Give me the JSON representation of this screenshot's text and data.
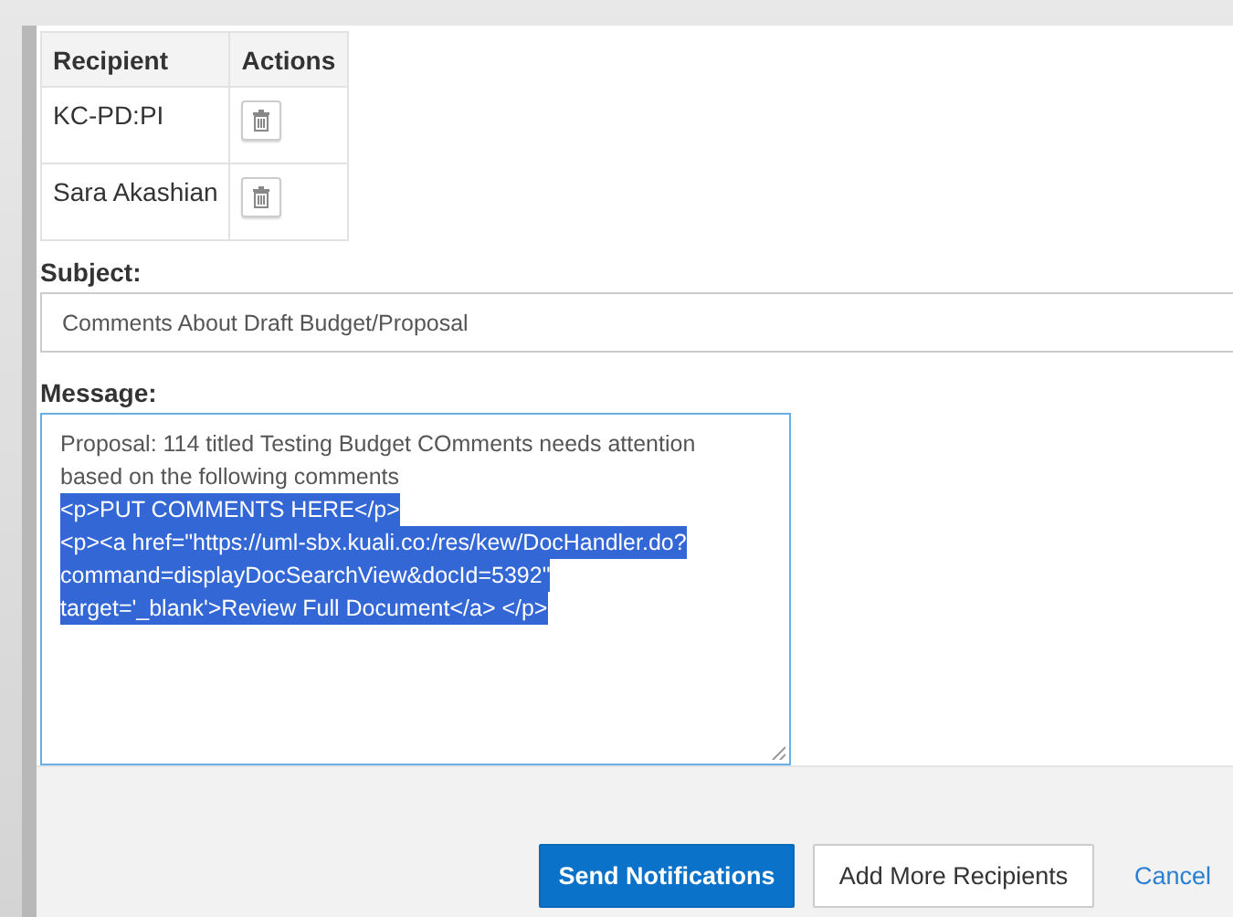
{
  "recipients_table": {
    "columns": [
      "Recipient",
      "Actions"
    ],
    "rows": [
      {
        "recipient": "KC-PD:PI"
      },
      {
        "recipient": "Sara Akashian"
      }
    ]
  },
  "subject": {
    "label": "Subject:",
    "value": "Comments About Draft Budget/Proposal"
  },
  "message": {
    "label": "Message:",
    "lines": [
      {
        "text": "Proposal: 114 titled Testing Budget COmments needs attention",
        "selected": false
      },
      {
        "text": "based on the following comments",
        "selected": false
      },
      {
        "text": "<p>PUT COMMENTS HERE</p>",
        "selected": true
      },
      {
        "text": "<p><a href=\"https://uml-sbx.kuali.co:/res/kew/DocHandler.do?",
        "selected": true
      },
      {
        "text": "command=displayDocSearchView&docId=5392\"",
        "selected": true
      },
      {
        "text": "target='_blank'>Review Full Document</a> </p>",
        "selected": true
      }
    ]
  },
  "buttons": [
    {
      "label": "Send Notifications",
      "kind": "primary"
    },
    {
      "label": "Add More Recipients",
      "kind": "secondary"
    },
    {
      "label": "Cancel",
      "kind": "link"
    }
  ]
}
